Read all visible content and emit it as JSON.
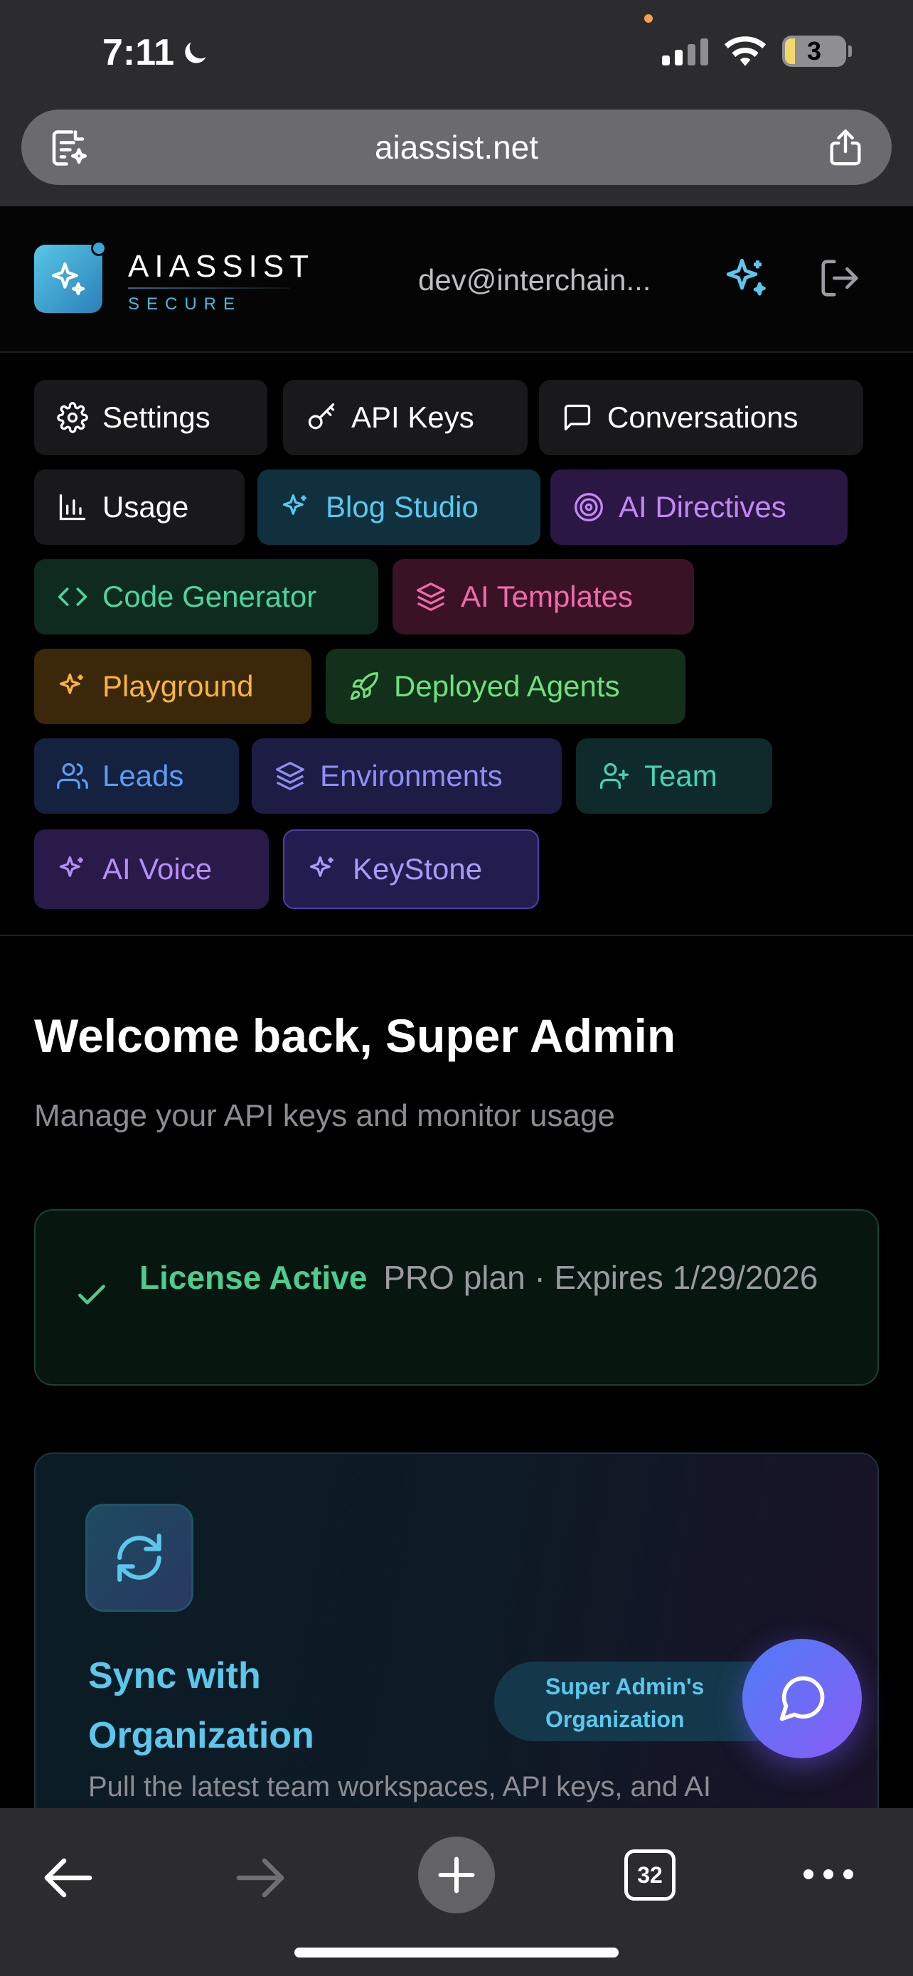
{
  "status_bar": {
    "time": "7:11",
    "battery": "3"
  },
  "browser": {
    "url": "aiassist.net",
    "tab_count": "32"
  },
  "header": {
    "brand_name": "AIASSIST",
    "brand_sub": "SECURE",
    "user_email": "dev@interchain..."
  },
  "nav": {
    "items": [
      {
        "label": "Settings",
        "icon": "gear-icon"
      },
      {
        "label": "API Keys",
        "icon": "key-icon"
      },
      {
        "label": "Conversations",
        "icon": "message-square-icon"
      },
      {
        "label": "Usage",
        "icon": "bar-chart-icon"
      },
      {
        "label": "Blog Studio",
        "icon": "sparkles-icon"
      },
      {
        "label": "AI Directives",
        "icon": "target-icon"
      },
      {
        "label": "Code Generator",
        "icon": "code-icon"
      },
      {
        "label": "AI Templates",
        "icon": "layers-icon"
      },
      {
        "label": "Playground",
        "icon": "sparkles-icon"
      },
      {
        "label": "Deployed Agents",
        "icon": "rocket-icon"
      },
      {
        "label": "Leads",
        "icon": "users-icon"
      },
      {
        "label": "Environments",
        "icon": "layers-icon"
      },
      {
        "label": "Team",
        "icon": "user-plus-icon"
      },
      {
        "label": "AI Voice",
        "icon": "sparkles-icon"
      },
      {
        "label": "KeyStone",
        "icon": "sparkles-icon"
      }
    ]
  },
  "main": {
    "welcome": "Welcome back, Super Admin",
    "subtitle": "Manage your API keys and monitor usage",
    "license": {
      "status": "License Active",
      "detail": "PRO plan · Expires 1/29/2026"
    },
    "sync": {
      "title": "Sync with Organization",
      "description": "Pull the latest team workspaces, API keys, and AI",
      "org_badge": "Super Admin's Organization"
    }
  },
  "colors": {
    "accent_cyan": "#5cc7ec",
    "license_green": "#4ecb8e",
    "background": "#000000"
  }
}
